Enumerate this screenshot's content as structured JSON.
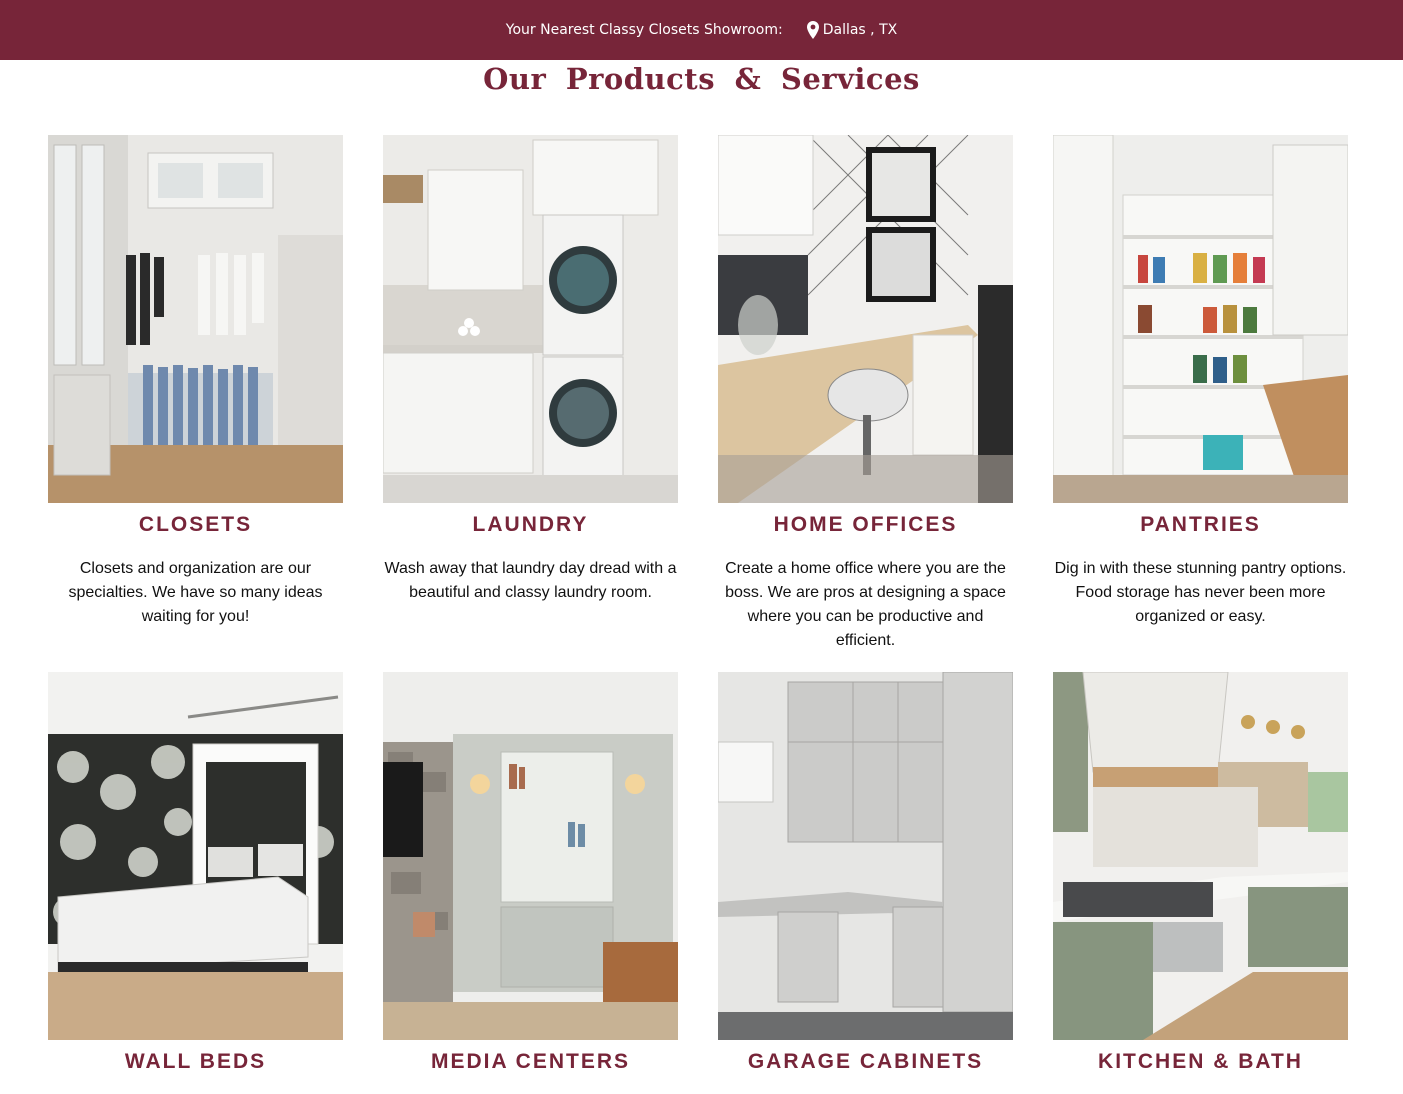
{
  "header": {
    "showroom_label": "Your Nearest Classy Closets Showroom:",
    "location": "Dallas , TX",
    "background": "#772539"
  },
  "section": {
    "title": "Our  Products  &  Services"
  },
  "products": [
    {
      "title": "CLOSETS",
      "description": "Closets and organization are our specialties. We have so many ideas waiting for you!"
    },
    {
      "title": "LAUNDRY",
      "description": "Wash away that laundry day dread with a beautiful and classy laundry room."
    },
    {
      "title": "HOME OFFICES",
      "description": "Create a home office where you are the boss. We are pros at designing a space where you can be productive and efficient."
    },
    {
      "title": "PANTRIES",
      "description": "Dig in with these stunning pantry options. Food storage has never been more organized or easy."
    },
    {
      "title": "WALL BEDS",
      "description": ""
    },
    {
      "title": "MEDIA CENTERS",
      "description": ""
    },
    {
      "title": "GARAGE CABINETS",
      "description": ""
    },
    {
      "title": "KITCHEN & BATH",
      "description": ""
    }
  ],
  "accent_color": "#772539"
}
